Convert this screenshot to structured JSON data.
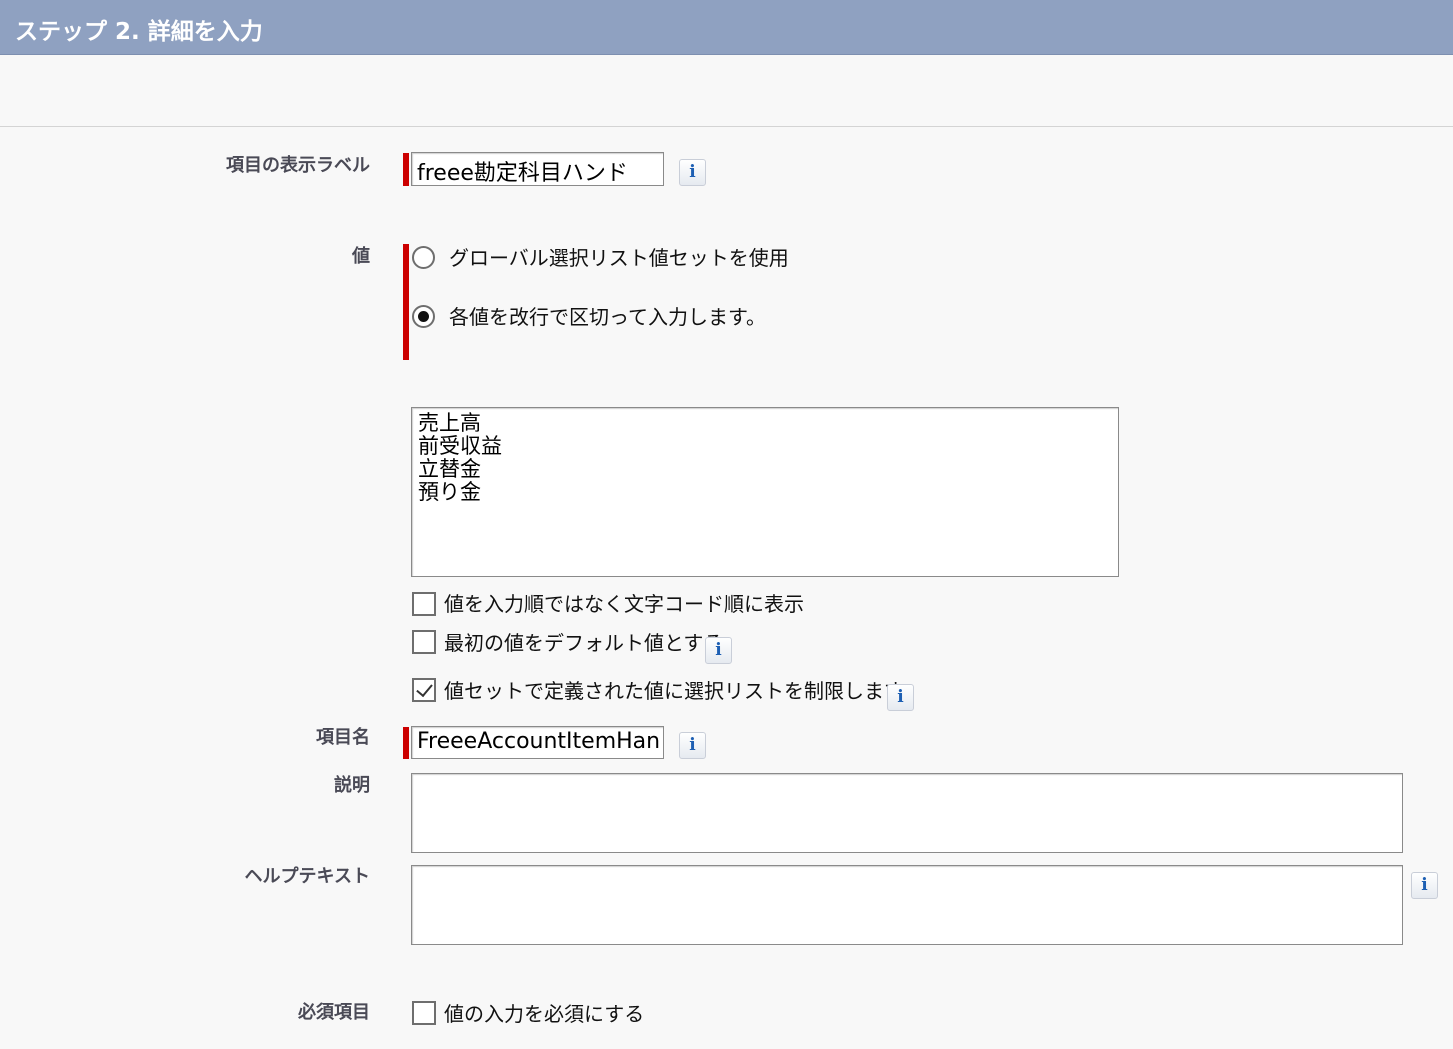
{
  "header": {
    "title": "ステップ 2. 詳細を入力"
  },
  "fields": {
    "display_label": {
      "label": "項目の表示ラベル",
      "value": "freee勘定科目ハンド"
    },
    "values": {
      "label": "値",
      "option_global": "グローバル選択リスト値セットを使用",
      "option_enter": "各値を改行で区切って入力します。",
      "selected": "option_enter",
      "entries": [
        "売上高",
        "前受収益",
        "立替金",
        "預り金"
      ],
      "sort_alpha": {
        "label": "値を入力順ではなく文字コード順に表示",
        "checked": false
      },
      "first_default": {
        "label": "最初の値をデフォルト値とする",
        "checked": false
      },
      "restrict": {
        "label": "値セットで定義された値に選択リストを制限します",
        "checked": true
      }
    },
    "field_name": {
      "label": "項目名",
      "value": "FreeeAccountItemHan"
    },
    "description": {
      "label": "説明",
      "value": ""
    },
    "help_text": {
      "label": "ヘルプテキスト",
      "value": ""
    },
    "required": {
      "label": "必須項目",
      "checkbox_label": "値の入力を必須にする",
      "checked": false
    }
  },
  "info_icon_glyph": "i",
  "colors": {
    "header_bg": "#8fa1c1",
    "required_bar": "#cc0000",
    "info_icon": "#1d5fb3"
  }
}
